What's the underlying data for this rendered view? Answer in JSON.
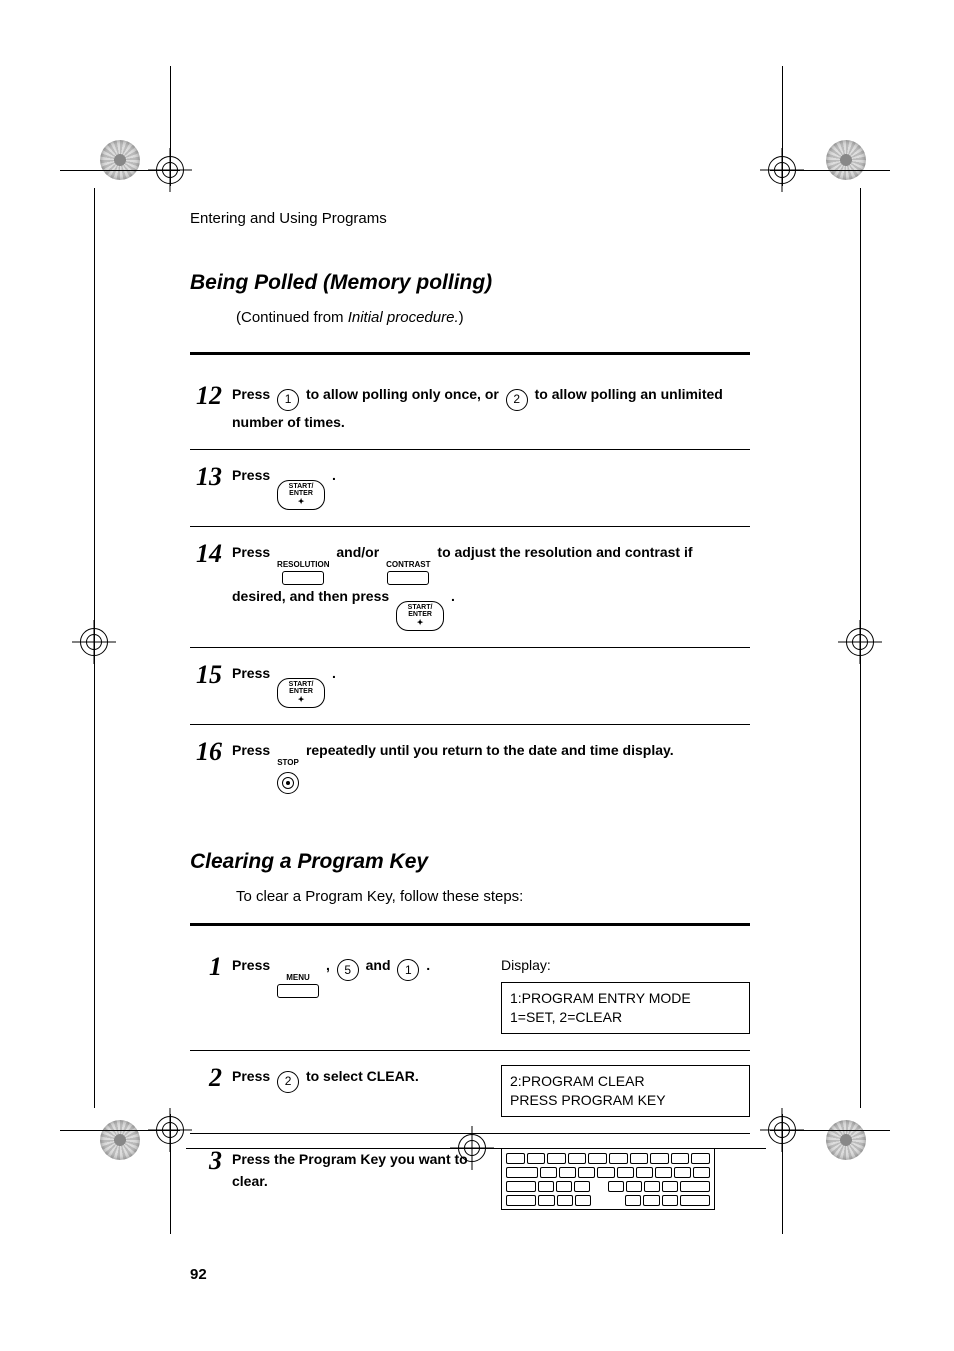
{
  "running_head": "Entering and Using Programs",
  "section1": {
    "title": "Being Polled (Memory polling)",
    "continued_prefix": "(Continued from ",
    "continued_ital": "Initial procedure.",
    "continued_suffix": ")",
    "steps": {
      "s12": {
        "num": "12",
        "t1": "Press ",
        "k1": "1",
        "t2": " to allow polling only once, or ",
        "k2": "2",
        "t3": " to allow polling an unlimited number of times."
      },
      "s13": {
        "num": "13",
        "t1": "Press ",
        "key_top": "START/",
        "key_bot": "ENTER",
        "t2": "."
      },
      "s14": {
        "num": "14",
        "t1": "Press ",
        "k_res": "RESOLUTION",
        "t2": " and/or ",
        "k_con": "CONTRAST",
        "t3": " to adjust the resolution and contrast if desired, and then press ",
        "key_top": "START/",
        "key_bot": "ENTER",
        "t4": "."
      },
      "s15": {
        "num": "15",
        "t1": "Press ",
        "key_top": "START/",
        "key_bot": "ENTER",
        "t2": "."
      },
      "s16": {
        "num": "16",
        "t1": "Press ",
        "k_stop": "STOP",
        "t2": " repeatedly until you return to the date and time display."
      }
    }
  },
  "section2": {
    "title": "Clearing a Program Key",
    "intro": "To clear a Program Key, follow these steps:",
    "display_label": "Display:",
    "steps": {
      "s1": {
        "num": "1",
        "t1": "Press ",
        "k_menu": "MENU",
        "t2": " , ",
        "k5": "5",
        "t3": " and ",
        "k1": "1",
        "t4": " .",
        "disp_l1": "1:PROGRAM ENTRY MODE",
        "disp_l2": "1=SET, 2=CLEAR"
      },
      "s2": {
        "num": "2",
        "t1": "Press ",
        "k2": "2",
        "t2": " to select CLEAR.",
        "disp_l1": "2:PROGRAM CLEAR",
        "disp_l2": "PRESS PROGRAM KEY"
      },
      "s3": {
        "num": "3",
        "t1": "Press the Program Key you want to clear."
      }
    }
  },
  "page_number": "92"
}
